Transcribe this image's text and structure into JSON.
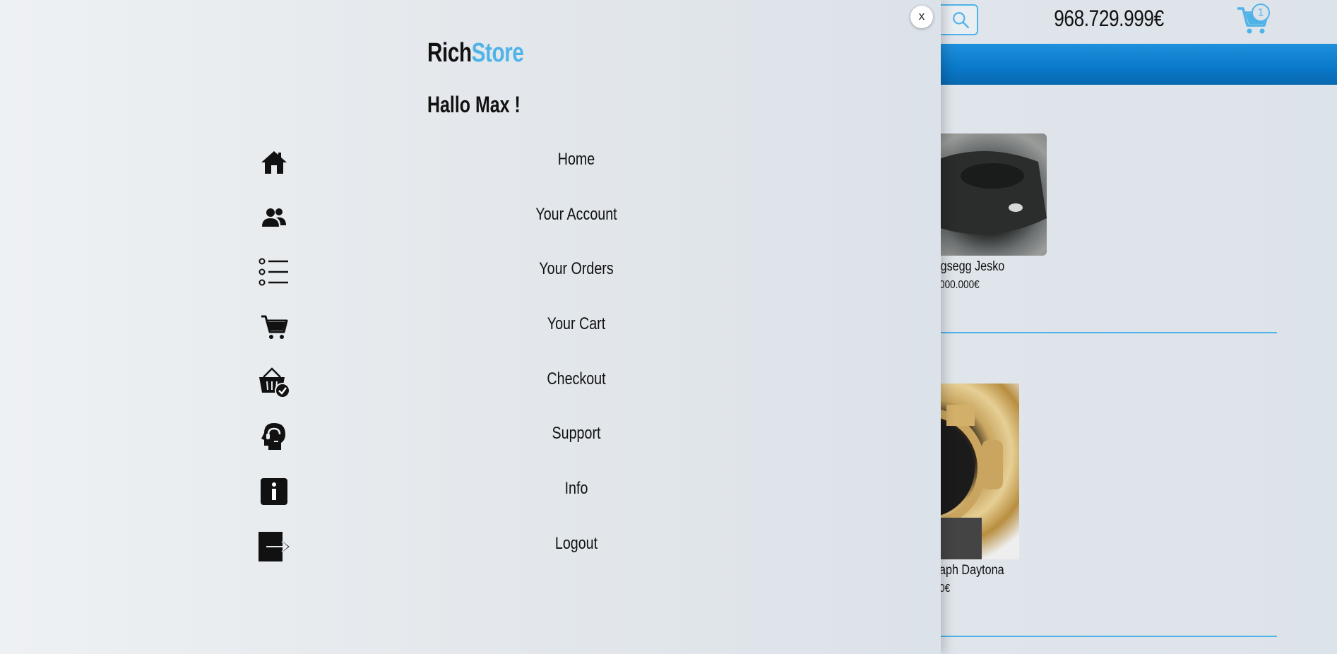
{
  "header": {
    "balance": "968.729.999€",
    "cart_count": "1"
  },
  "products": [
    {
      "name": "igsegg Jesko",
      "price": "000.000€"
    },
    {
      "name": "aph Daytona",
      "price": "0€"
    }
  ],
  "side_menu": {
    "close_label": "x",
    "brand_part1": "Rich",
    "brand_part2": "Store",
    "greeting": "Hallo Max !",
    "items": [
      {
        "label": "Home",
        "icon": "home-icon"
      },
      {
        "label": "Your Account",
        "icon": "users-icon"
      },
      {
        "label": "Your Orders",
        "icon": "list-icon"
      },
      {
        "label": "Your Cart",
        "icon": "cart-icon"
      },
      {
        "label": "Checkout",
        "icon": "basket-check-icon"
      },
      {
        "label": "Support",
        "icon": "headset-icon"
      },
      {
        "label": "Info",
        "icon": "info-icon"
      },
      {
        "label": "Logout",
        "icon": "logout-icon"
      }
    ]
  },
  "colors": {
    "accent": "#4fb3e8",
    "nav_bar": "#0a78c8"
  }
}
